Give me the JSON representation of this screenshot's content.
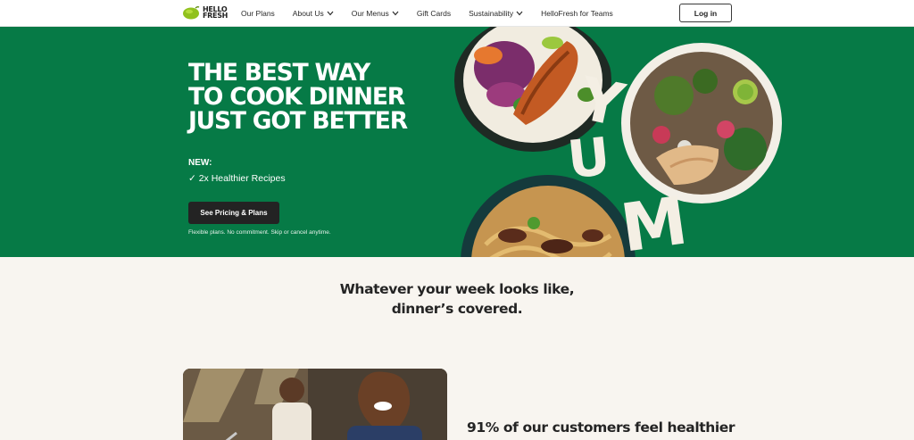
{
  "nav": {
    "logo_line1": "HELLO",
    "logo_line2": "FRESH",
    "items": [
      {
        "label": "Our Plans",
        "dropdown": false
      },
      {
        "label": "About Us",
        "dropdown": true
      },
      {
        "label": "Our Menus",
        "dropdown": true
      },
      {
        "label": "Gift Cards",
        "dropdown": false
      },
      {
        "label": "Sustainability",
        "dropdown": true
      },
      {
        "label": "HelloFresh for Teams",
        "dropdown": false
      }
    ],
    "login_label": "Log in"
  },
  "hero": {
    "title_lines": [
      "THE BEST WAY",
      "TO COOK DINNER",
      "JUST GOT BETTER"
    ],
    "new_label": "NEW:",
    "new_item": "✓ 2x Healthier Recipes",
    "cta_label": "See Pricing & Plans",
    "fine_print": "Flexible plans. No commitment. Skip or cancel anytime.",
    "yum_letters": [
      "Y",
      "U",
      "M"
    ],
    "background_color": "#067a46",
    "images": [
      "salmon-rice-bowl",
      "chicken-grain-bowl",
      "beef-noodle-bowl"
    ]
  },
  "main": {
    "section_title_line1": "Whatever your week looks like,",
    "section_title_line2": "dinner’s covered.",
    "photo": "couple-cooking-photo",
    "stat_text": "91% of our customers feel healthier"
  },
  "colors": {
    "brand_green": "#067a46",
    "lime": "#91c11e",
    "dark": "#232323",
    "cream": "#f8f5f0"
  }
}
